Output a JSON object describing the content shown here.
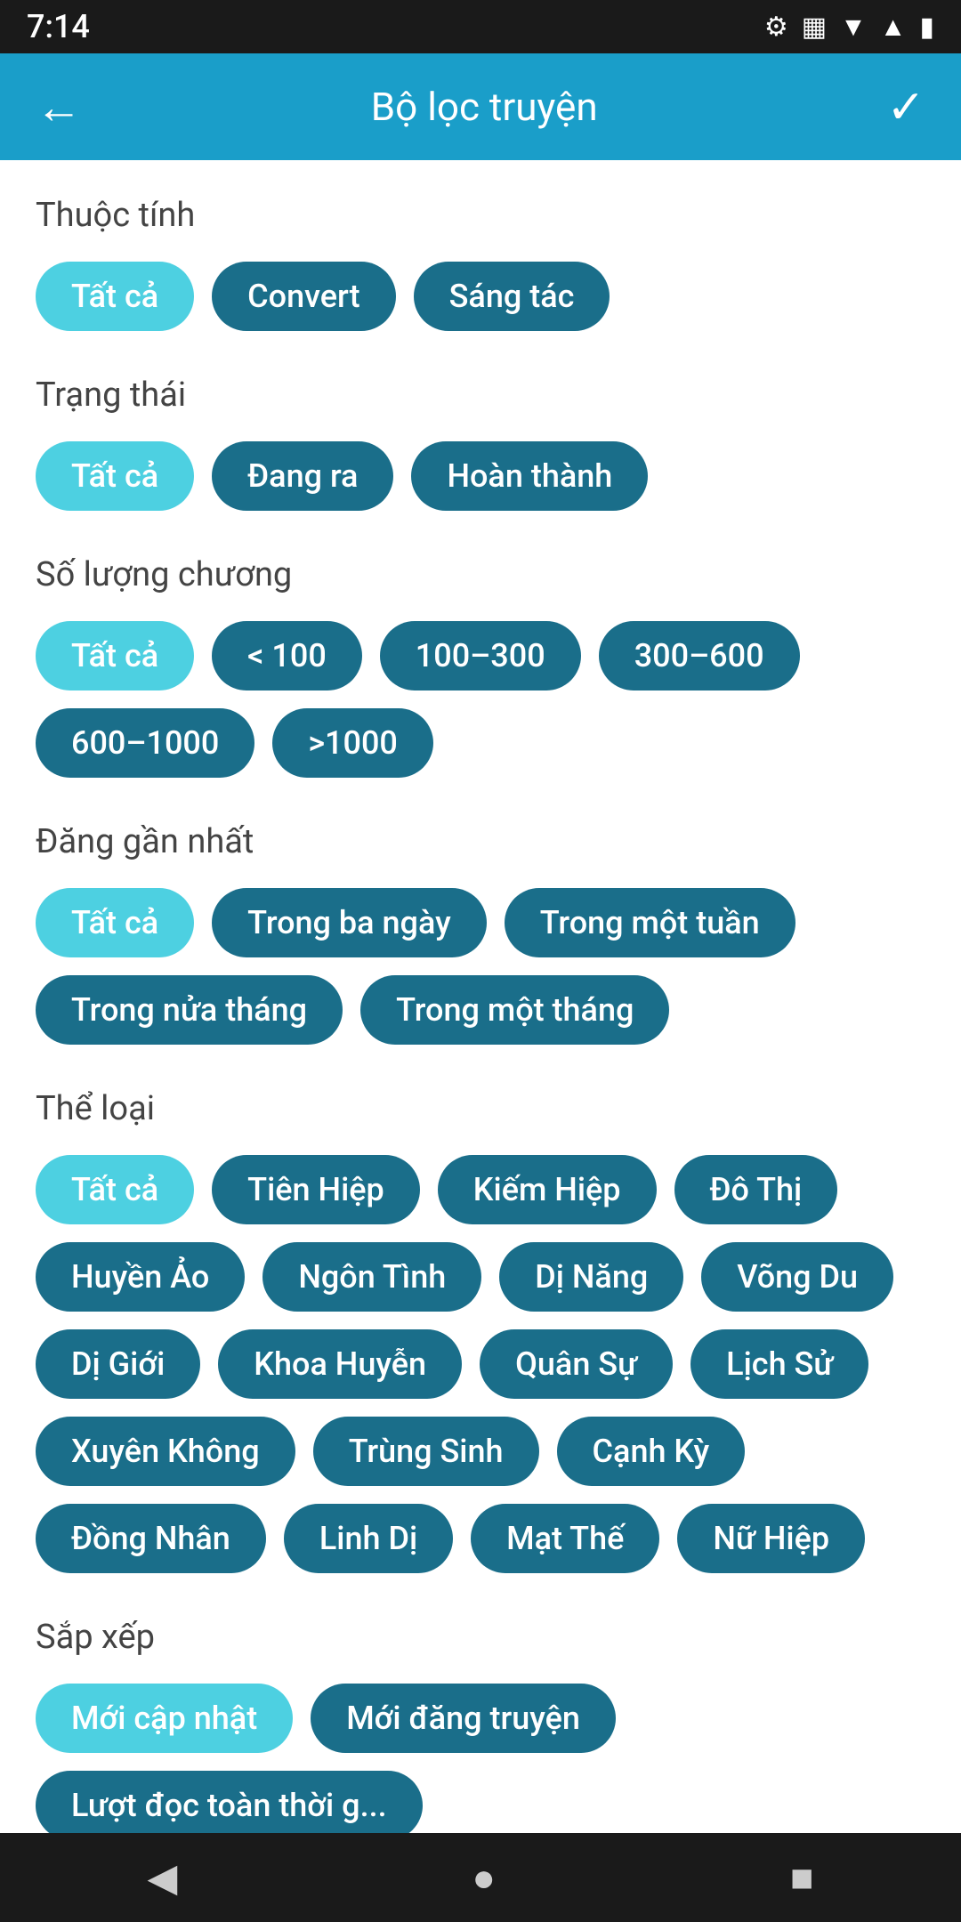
{
  "statusBar": {
    "time": "7:14"
  },
  "appBar": {
    "title": "Bộ lọc truyện",
    "backLabel": "←",
    "confirmLabel": "✓"
  },
  "sections": [
    {
      "id": "thuoc-tinh",
      "label": "Thuộc tính",
      "chips": [
        {
          "id": "tat-ca-1",
          "label": "Tất cả",
          "active": true
        },
        {
          "id": "convert",
          "label": "Convert",
          "active": false
        },
        {
          "id": "sang-tac",
          "label": "Sáng tác",
          "active": false
        }
      ]
    },
    {
      "id": "trang-thai",
      "label": "Trạng thái",
      "chips": [
        {
          "id": "tat-ca-2",
          "label": "Tất cả",
          "active": true
        },
        {
          "id": "dang-ra",
          "label": "Đang ra",
          "active": false
        },
        {
          "id": "hoan-thanh",
          "label": "Hoàn thành",
          "active": false
        }
      ]
    },
    {
      "id": "so-luong-chuong",
      "label": "Số lượng chương",
      "chips": [
        {
          "id": "tat-ca-3",
          "label": "Tất cả",
          "active": true
        },
        {
          "id": "lt-100",
          "label": "< 100",
          "active": false
        },
        {
          "id": "100-300",
          "label": "100–300",
          "active": false
        },
        {
          "id": "300-600",
          "label": "300–600",
          "active": false
        },
        {
          "id": "600-1000",
          "label": "600–1000",
          "active": false
        },
        {
          "id": "gt-1000",
          "label": ">1000",
          "active": false
        }
      ]
    },
    {
      "id": "dang-gan-nhat",
      "label": "Đăng gần nhất",
      "chips": [
        {
          "id": "tat-ca-4",
          "label": "Tất cả",
          "active": true
        },
        {
          "id": "trong-ba-ngay",
          "label": "Trong ba ngày",
          "active": false
        },
        {
          "id": "trong-mot-tuan",
          "label": "Trong một tuần",
          "active": false
        },
        {
          "id": "trong-nua-thang",
          "label": "Trong nửa tháng",
          "active": false
        },
        {
          "id": "trong-mot-thang",
          "label": "Trong một tháng",
          "active": false
        }
      ]
    },
    {
      "id": "the-loai",
      "label": "Thể loại",
      "chips": [
        {
          "id": "tat-ca-5",
          "label": "Tất cả",
          "active": true
        },
        {
          "id": "tien-hiep",
          "label": "Tiên Hiệp",
          "active": false
        },
        {
          "id": "kiem-hiep",
          "label": "Kiếm Hiệp",
          "active": false
        },
        {
          "id": "do-thi",
          "label": "Đô Thị",
          "active": false
        },
        {
          "id": "huyen-ao",
          "label": "Huyền Ảo",
          "active": false
        },
        {
          "id": "ngon-tinh",
          "label": "Ngôn Tình",
          "active": false
        },
        {
          "id": "di-nang",
          "label": "Dị Năng",
          "active": false
        },
        {
          "id": "vong-du",
          "label": "Võng Du",
          "active": false
        },
        {
          "id": "di-gioi",
          "label": "Dị Giới",
          "active": false
        },
        {
          "id": "khoa-huyen",
          "label": "Khoa Huyễn",
          "active": false
        },
        {
          "id": "quan-su",
          "label": "Quân Sự",
          "active": false
        },
        {
          "id": "lich-su",
          "label": "Lịch Sử",
          "active": false
        },
        {
          "id": "xuyen-khong",
          "label": "Xuyên Không",
          "active": false
        },
        {
          "id": "trung-sinh",
          "label": "Trùng Sinh",
          "active": false
        },
        {
          "id": "canh-ky",
          "label": "Cạnh Kỳ",
          "active": false
        },
        {
          "id": "dong-nhan",
          "label": "Đồng Nhân",
          "active": false
        },
        {
          "id": "linh-di",
          "label": "Linh Dị",
          "active": false
        },
        {
          "id": "mat-the",
          "label": "Mạt Thế",
          "active": false
        },
        {
          "id": "nu-hiep",
          "label": "Nữ Hiệp",
          "active": false
        }
      ]
    },
    {
      "id": "sap-xep",
      "label": "Sắp xếp",
      "chips": [
        {
          "id": "moi-cap-nhat",
          "label": "Mới cập nhật",
          "active": true
        },
        {
          "id": "moi-dang-truyen",
          "label": "Mới đăng truyện",
          "active": false
        },
        {
          "id": "luot-doc-toan-thoi-g",
          "label": "Lượt đọc toàn thời g...",
          "active": false
        }
      ]
    }
  ],
  "bottomNav": {
    "back": "◀",
    "home": "●",
    "recent": "■"
  }
}
